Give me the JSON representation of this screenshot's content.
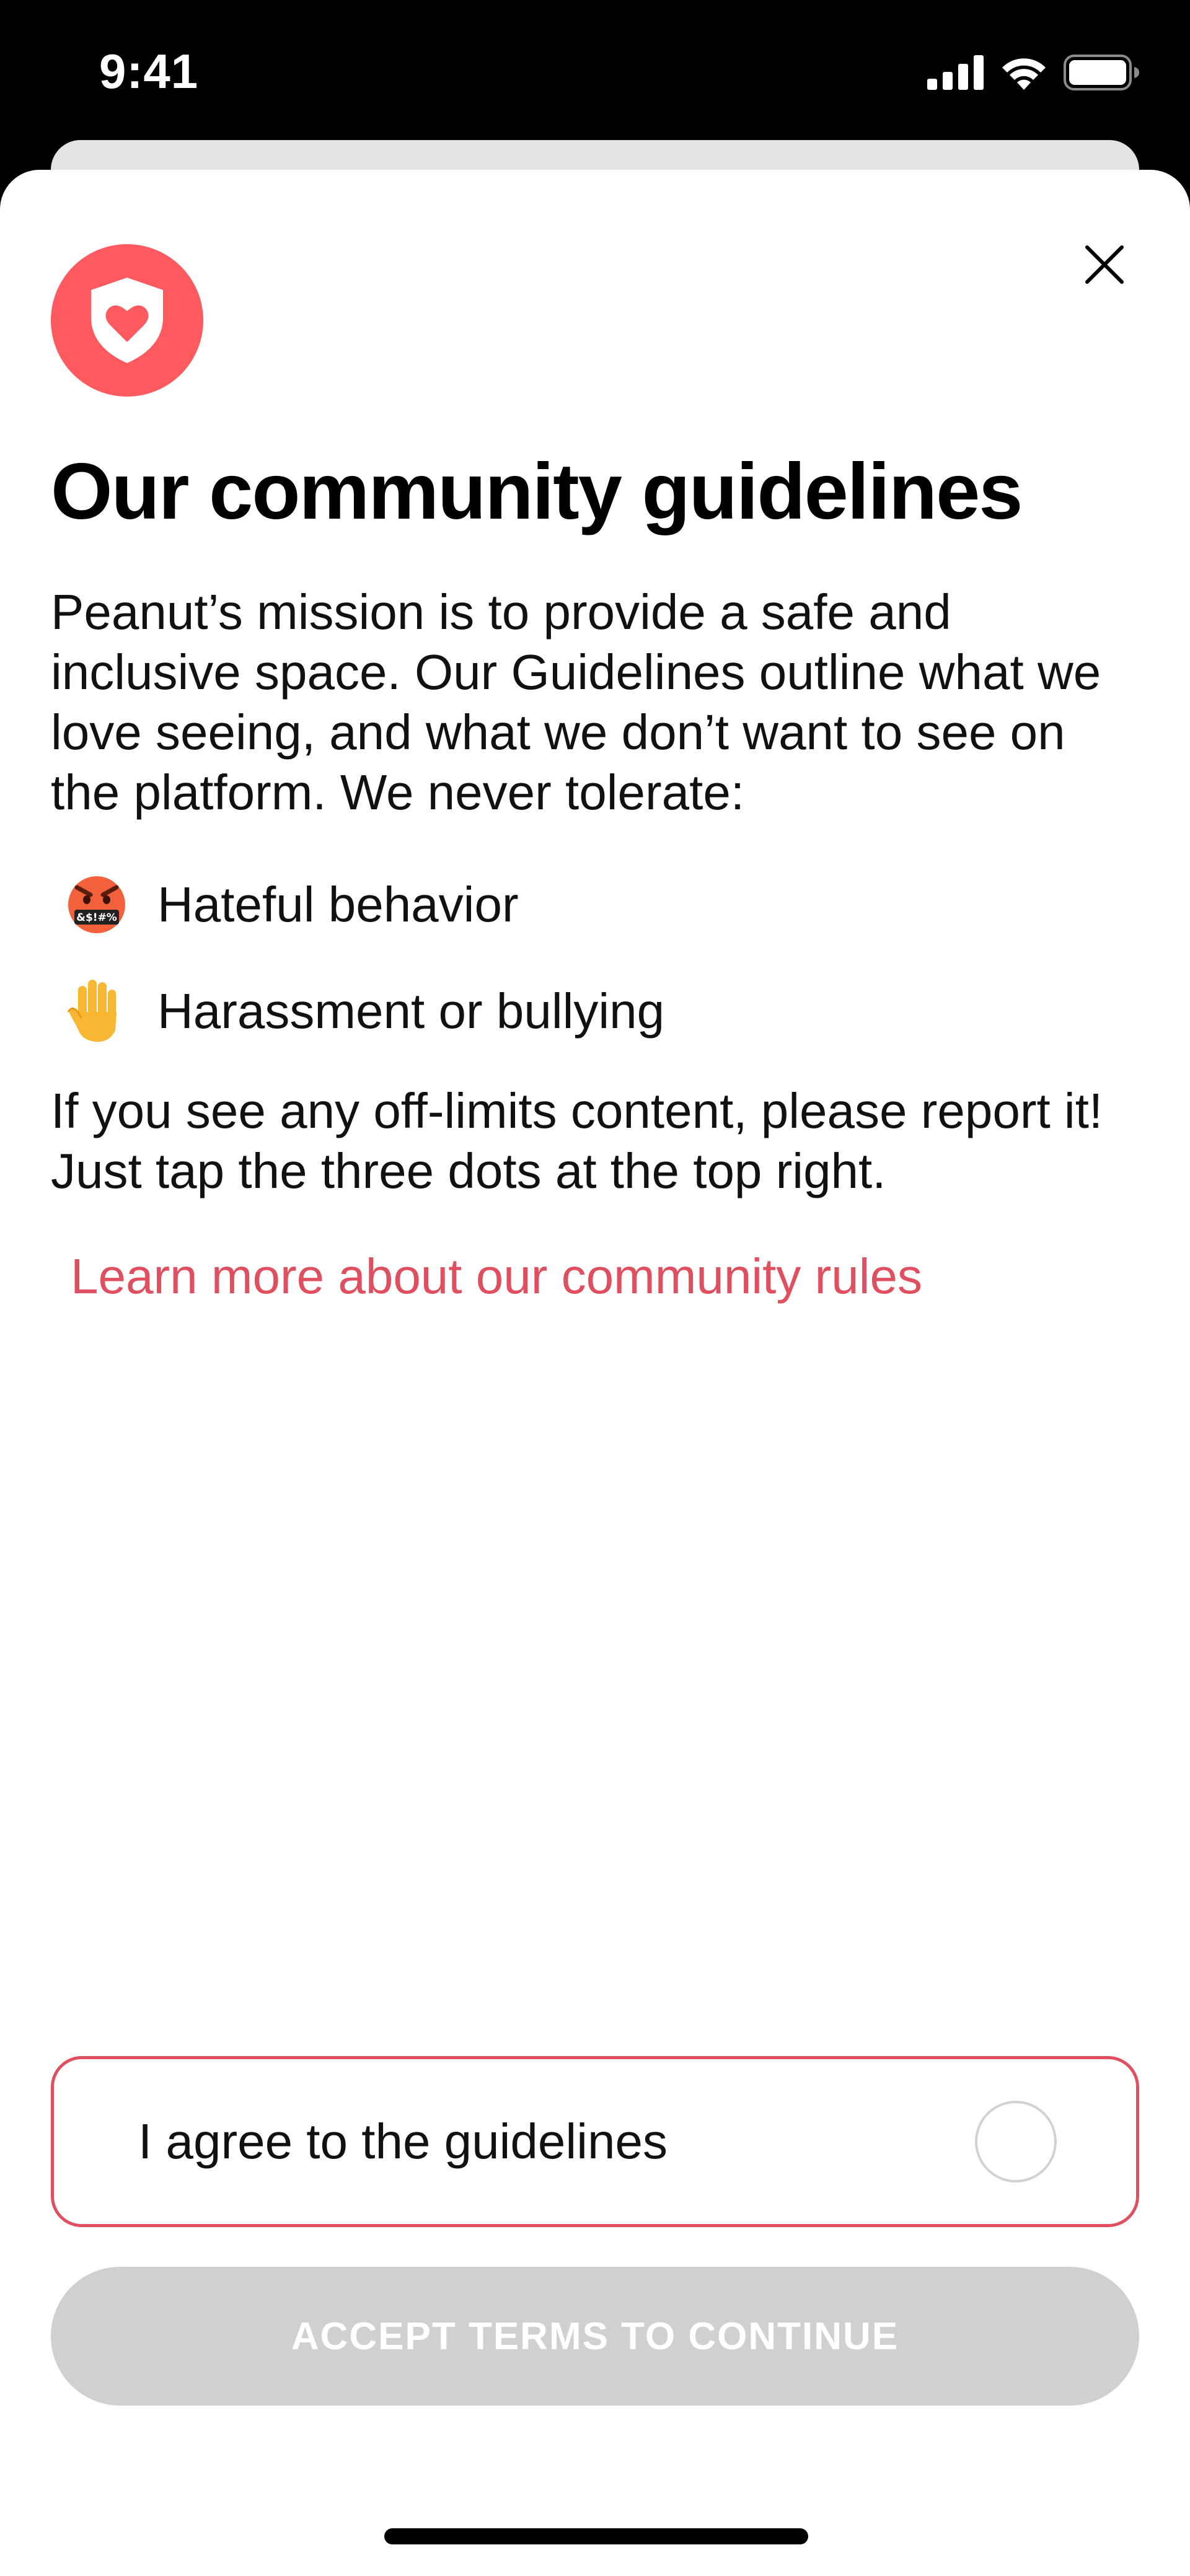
{
  "status_bar": {
    "time": "9:41",
    "icons": [
      "cellular-signal-icon",
      "wifi-icon",
      "battery-icon"
    ]
  },
  "modal": {
    "logo_icon": "shield-heart-icon",
    "close_icon": "close-icon",
    "title": "Our community guidelines",
    "intro": "Peanut’s mission is to provide a safe and inclusive space. Our Guidelines outline what we love seeing, and what we don’t want to see on the platform. We never tolerate:",
    "rules": [
      {
        "icon": "angry-face-with-symbols-emoji",
        "label": "Hateful behavior"
      },
      {
        "icon": "raised-hand-emoji",
        "label": "Harassment or bullying"
      }
    ],
    "report_text": "If you see any off-limits content, please report it! Just tap the three dots at the top right.",
    "learn_more_link": "Learn more about our community rules",
    "agree_label": "I agree to the guidelines",
    "agree_checked": false,
    "accept_button_label": "ACCEPT TERMS TO CONTINUE",
    "accept_button_enabled": false
  },
  "colors": {
    "brand": "#ff5a5f",
    "link": "#e04f5f",
    "disabled_button": "#d0d0d0",
    "status_bar_bg": "#000000"
  }
}
